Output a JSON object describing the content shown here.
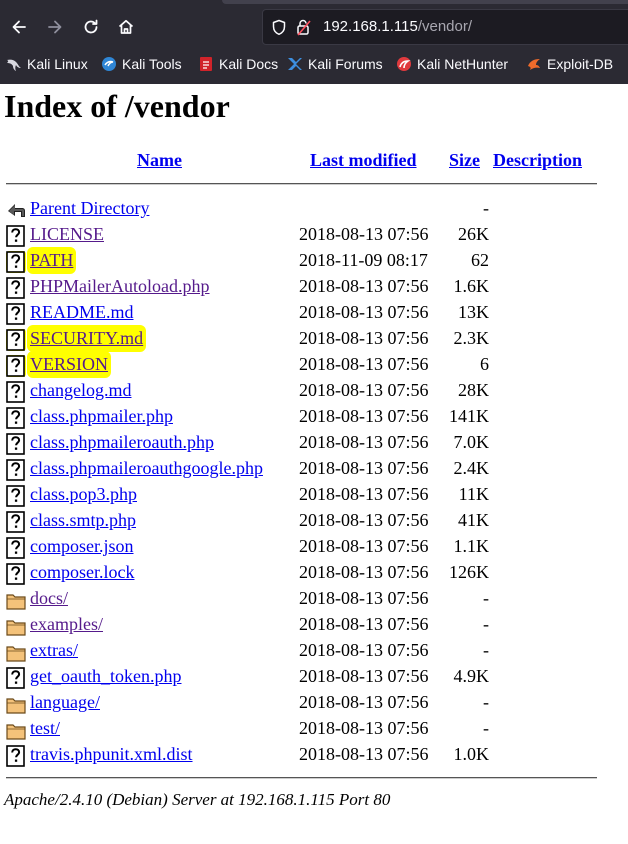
{
  "browser": {
    "url_host": "192.168.1.115",
    "url_path": "/vendor/",
    "bookmarks": [
      {
        "label": "Kali Linux",
        "icon": "kali-dragon-icon"
      },
      {
        "label": "Kali Tools",
        "icon": "kali-tools-icon"
      },
      {
        "label": "Kali Docs",
        "icon": "kali-docs-icon"
      },
      {
        "label": "Kali Forums",
        "icon": "kali-forums-icon"
      },
      {
        "label": "Kali NetHunter",
        "icon": "kali-nethunter-icon"
      },
      {
        "label": "Exploit-DB",
        "icon": "exploit-db-icon"
      }
    ]
  },
  "page": {
    "title": "Index of /vendor",
    "columns": {
      "name": "Name",
      "modified": "Last modified",
      "size": "Size",
      "description": "Description"
    },
    "rows": [
      {
        "name": "Parent Directory",
        "modified": "",
        "size": "-",
        "type": "parent",
        "visited": false,
        "highlight": false
      },
      {
        "name": "LICENSE",
        "modified": "2018-08-13 07:56",
        "size": "26K",
        "type": "file",
        "visited": true,
        "highlight": false
      },
      {
        "name": "PATH",
        "modified": "2018-11-09 08:17",
        "size": "62",
        "type": "file",
        "visited": true,
        "highlight": true
      },
      {
        "name": "PHPMailerAutoload.php",
        "modified": "2018-08-13 07:56",
        "size": "1.6K",
        "type": "file",
        "visited": true,
        "highlight": false
      },
      {
        "name": "README.md",
        "modified": "2018-08-13 07:56",
        "size": "13K",
        "type": "file",
        "visited": false,
        "highlight": false
      },
      {
        "name": "SECURITY.md",
        "modified": "2018-08-13 07:56",
        "size": "2.3K",
        "type": "file",
        "visited": true,
        "highlight": true
      },
      {
        "name": "VERSION",
        "modified": "2018-08-13 07:56",
        "size": "6",
        "type": "file",
        "visited": true,
        "highlight": true
      },
      {
        "name": "changelog.md",
        "modified": "2018-08-13 07:56",
        "size": "28K",
        "type": "file",
        "visited": false,
        "highlight": false
      },
      {
        "name": "class.phpmailer.php",
        "modified": "2018-08-13 07:56",
        "size": "141K",
        "type": "file",
        "visited": false,
        "highlight": false
      },
      {
        "name": "class.phpmaileroauth.php",
        "modified": "2018-08-13 07:56",
        "size": "7.0K",
        "type": "file",
        "visited": false,
        "highlight": false
      },
      {
        "name": "class.phpmaileroauthgoogle.php",
        "modified": "2018-08-13 07:56",
        "size": "2.4K",
        "type": "file",
        "visited": false,
        "highlight": false
      },
      {
        "name": "class.pop3.php",
        "modified": "2018-08-13 07:56",
        "size": "11K",
        "type": "file",
        "visited": false,
        "highlight": false
      },
      {
        "name": "class.smtp.php",
        "modified": "2018-08-13 07:56",
        "size": "41K",
        "type": "file",
        "visited": false,
        "highlight": false
      },
      {
        "name": "composer.json",
        "modified": "2018-08-13 07:56",
        "size": "1.1K",
        "type": "file",
        "visited": false,
        "highlight": false
      },
      {
        "name": "composer.lock",
        "modified": "2018-08-13 07:56",
        "size": "126K",
        "type": "file",
        "visited": false,
        "highlight": false
      },
      {
        "name": "docs/",
        "modified": "2018-08-13 07:56",
        "size": "-",
        "type": "folder",
        "visited": true,
        "highlight": false
      },
      {
        "name": "examples/",
        "modified": "2018-08-13 07:56",
        "size": "-",
        "type": "folder",
        "visited": true,
        "highlight": false
      },
      {
        "name": "extras/",
        "modified": "2018-08-13 07:56",
        "size": "-",
        "type": "folder",
        "visited": false,
        "highlight": false
      },
      {
        "name": "get_oauth_token.php",
        "modified": "2018-08-13 07:56",
        "size": "4.9K",
        "type": "file",
        "visited": false,
        "highlight": false
      },
      {
        "name": "language/",
        "modified": "2018-08-13 07:56",
        "size": "-",
        "type": "folder",
        "visited": false,
        "highlight": false
      },
      {
        "name": "test/",
        "modified": "2018-08-13 07:56",
        "size": "-",
        "type": "folder",
        "visited": false,
        "highlight": false
      },
      {
        "name": "travis.phpunit.xml.dist",
        "modified": "2018-08-13 07:56",
        "size": "1.0K",
        "type": "file",
        "visited": false,
        "highlight": false
      }
    ],
    "footer": "Apache/2.4.10 (Debian) Server at 192.168.1.115 Port 80"
  },
  "colors": {
    "link": "#0000ee",
    "visited_link": "#551a8b",
    "highlight": "#ffff00",
    "chrome_bg": "#2b2a33"
  }
}
